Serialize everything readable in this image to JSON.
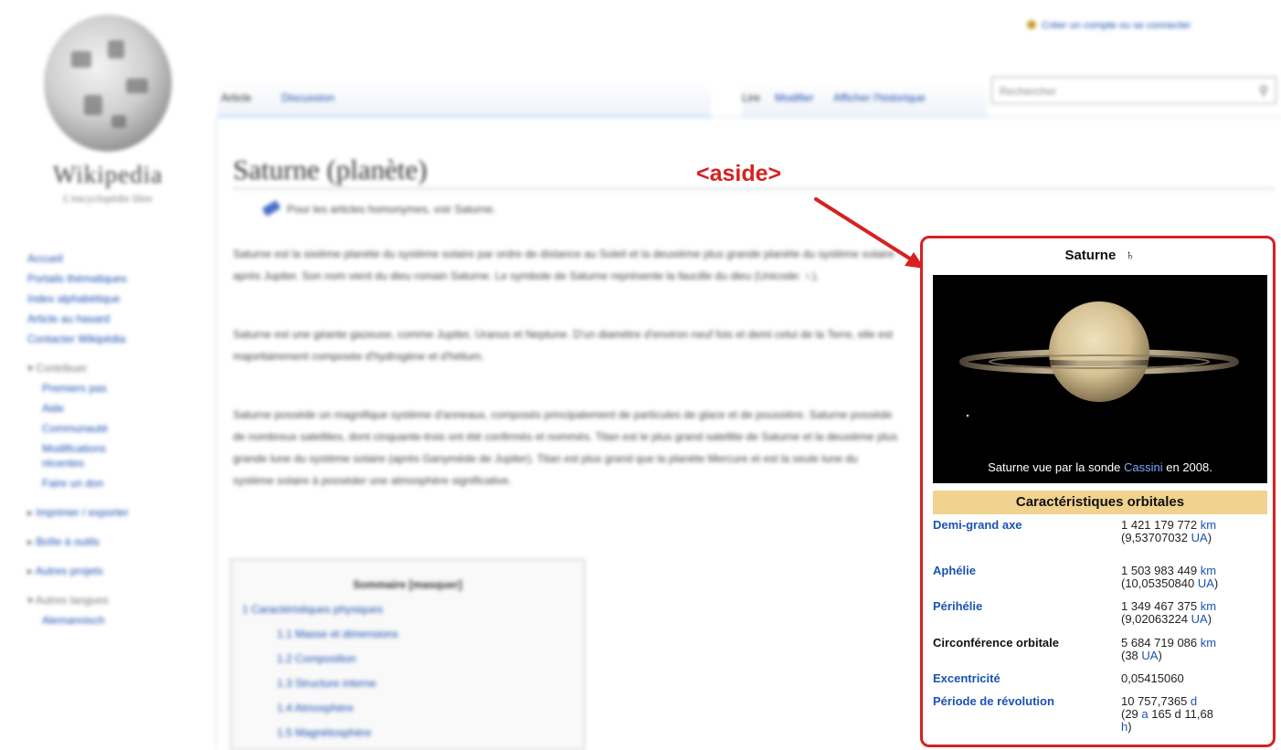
{
  "header": {
    "wordmark": "Wikipedia",
    "tagline": "L'encyclopédie libre",
    "user_links": "Créer un compte ou se connecter"
  },
  "tabs": {
    "article": "Article",
    "discussion": "Discussion",
    "read": "Lire",
    "edit": "Modifier",
    "history": "Afficher l'historique"
  },
  "search": {
    "placeholder": "Rechercher"
  },
  "sidebar": {
    "links": [
      "Accueil",
      "Portails thématiques",
      "Index alphabétique",
      "Article au hasard",
      "Contacter Wikipédia"
    ],
    "contribute_heading": "Contribuer",
    "contribute_links": [
      "Premiers pas",
      "Aide",
      "Communauté",
      "Modifications récentes",
      "Faire un don"
    ],
    "groups": [
      "Imprimer / exporter",
      "Boîte à outils",
      "Autres projets",
      "Autres langues"
    ],
    "languages": [
      "Alemannisch"
    ]
  },
  "article": {
    "title": "Saturne (planète)",
    "hatnote": "Pour les articles homonymes, voir Saturne.",
    "paragraphs": [
      "Saturne est la sixième planète du système solaire par ordre de distance au Soleil et la deuxième plus grande planète du système solaire après Jupiter. Son nom vient du dieu romain Saturne. Le symbole de Saturne représente la faucille du dieu (Unicode: ♄).",
      "Saturne est une géante gazeuse, comme Jupiter, Uranus et Neptune. D'un diamètre d'environ neuf fois et demi celui de la Terre, elle est majoritairement composée d'hydrogène et d'hélium.",
      "Saturne possède un magnifique système d'anneaux, composés principalement de particules de glace et de poussière. Saturne possède de nombreux satellites, dont cinquante-trois ont été confirmés et nommés. Titan est le plus grand satellite de Saturne et la deuxième plus grande lune du système solaire (après Ganymède de Jupiter). Titan est plus grand que la planète Mercure et est la seule lune du système solaire à posséder une atmosphère significative."
    ]
  },
  "toc": {
    "title": "Sommaire [masquer]",
    "items": [
      "1 Caractéristiques physiques"
    ],
    "subitems": [
      "1.1 Masse et dimensions",
      "1.2 Composition",
      "1.3 Structure interne",
      "1.4 Atmosphère",
      "1.5 Magnétosphère"
    ]
  },
  "annotation": {
    "label": "<aside>",
    "color": "#d62120"
  },
  "infobox": {
    "title": "Saturne",
    "symbol": "♄",
    "caption_text": "Saturne vue par la sonde ",
    "caption_link": "Cassini",
    "caption_end": " en 2008.",
    "section_title": "Caractéristiques orbitales",
    "rows": [
      {
        "label": "Demi-grand axe",
        "line1_num": "1 421 179 772 ",
        "line1_unit": "km",
        "line2_num": "(9,53707032 ",
        "line2_unit": "UA",
        "line2_end": ")"
      },
      {
        "label": "Aphélie",
        "line1_num": "1 503 983 449 ",
        "line1_unit": "km",
        "line2_num": "(10,05350840 ",
        "line2_unit": "UA",
        "line2_end": ")"
      },
      {
        "label": "Périhélie",
        "line1_num": "1 349 467 375 ",
        "line1_unit": "km",
        "line2_num": "(9,02063224 ",
        "line2_unit": "UA",
        "line2_end": ")"
      },
      {
        "label": "Circonférence orbitale",
        "line1_num": "5 684 719 086 ",
        "line1_unit": "km",
        "line2_num": "(38 ",
        "line2_unit": "UA",
        "line2_end": ")"
      },
      {
        "label": "Excentricité",
        "line1_num": "0,05415060"
      },
      {
        "label": "Période de révolution",
        "line1_num": "10 757,7365 ",
        "line1_unit": "d",
        "line2_num": "(29 ",
        "line2_unit": "a",
        "line2_mid": " 165 d 11,68",
        "line3_unit": "h",
        "line3_end": ")"
      }
    ],
    "colors": {
      "section_bg": "#f1d28e",
      "link": "#1b52b5",
      "frame": "#d62120"
    }
  }
}
